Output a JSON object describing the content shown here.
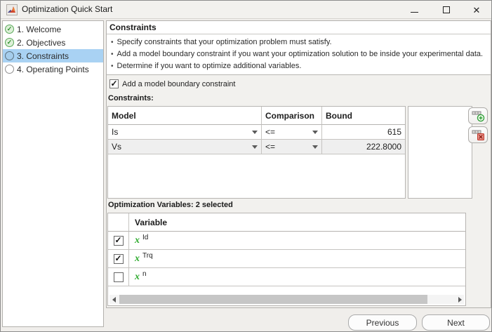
{
  "window": {
    "title": "Optimization Quick Start"
  },
  "sidebar": {
    "items": [
      {
        "label": "1. Welcome",
        "state": "complete"
      },
      {
        "label": "2. Objectives",
        "state": "complete"
      },
      {
        "label": "3. Constraints",
        "state": "active"
      },
      {
        "label": "4. Operating Points",
        "state": "pending"
      }
    ]
  },
  "main": {
    "heading": "Constraints",
    "bullets": [
      "Specify constraints that your optimization problem must satisfy.",
      "Add a model boundary constraint if you want your optimization solution to be inside your experimental data.",
      "Determine if you want to optimize additional variables."
    ],
    "boundary_checkbox": {
      "label": "Add a model boundary constraint",
      "checked": true
    },
    "constraints": {
      "label": "Constraints:",
      "columns": [
        "Model",
        "Comparison",
        "Bound"
      ],
      "rows": [
        {
          "model": "Is",
          "comparison": "<=",
          "bound": "615"
        },
        {
          "model": "Vs",
          "comparison": "<=",
          "bound": "222.8000"
        }
      ]
    },
    "variables": {
      "label": "Optimization Variables: 2 selected",
      "column": "Variable",
      "rows": [
        {
          "name": "Id",
          "checked": true
        },
        {
          "name": "Trq",
          "checked": true
        },
        {
          "name": "n",
          "checked": false
        }
      ]
    }
  },
  "footer": {
    "previous": "Previous",
    "next": "Next"
  },
  "icons": {
    "app": "matlab-logo-icon",
    "add_row": "table-add-icon",
    "delete_row": "table-delete-icon",
    "dropdown": "chevron-down-icon",
    "checkmark": "✓"
  },
  "colors": {
    "selection_blue": "#a9d2f3",
    "step_complete_green": "#58a758",
    "variable_x_green": "#2eab2e",
    "add_green": "#2f9e38",
    "delete_red": "#c0392b"
  }
}
